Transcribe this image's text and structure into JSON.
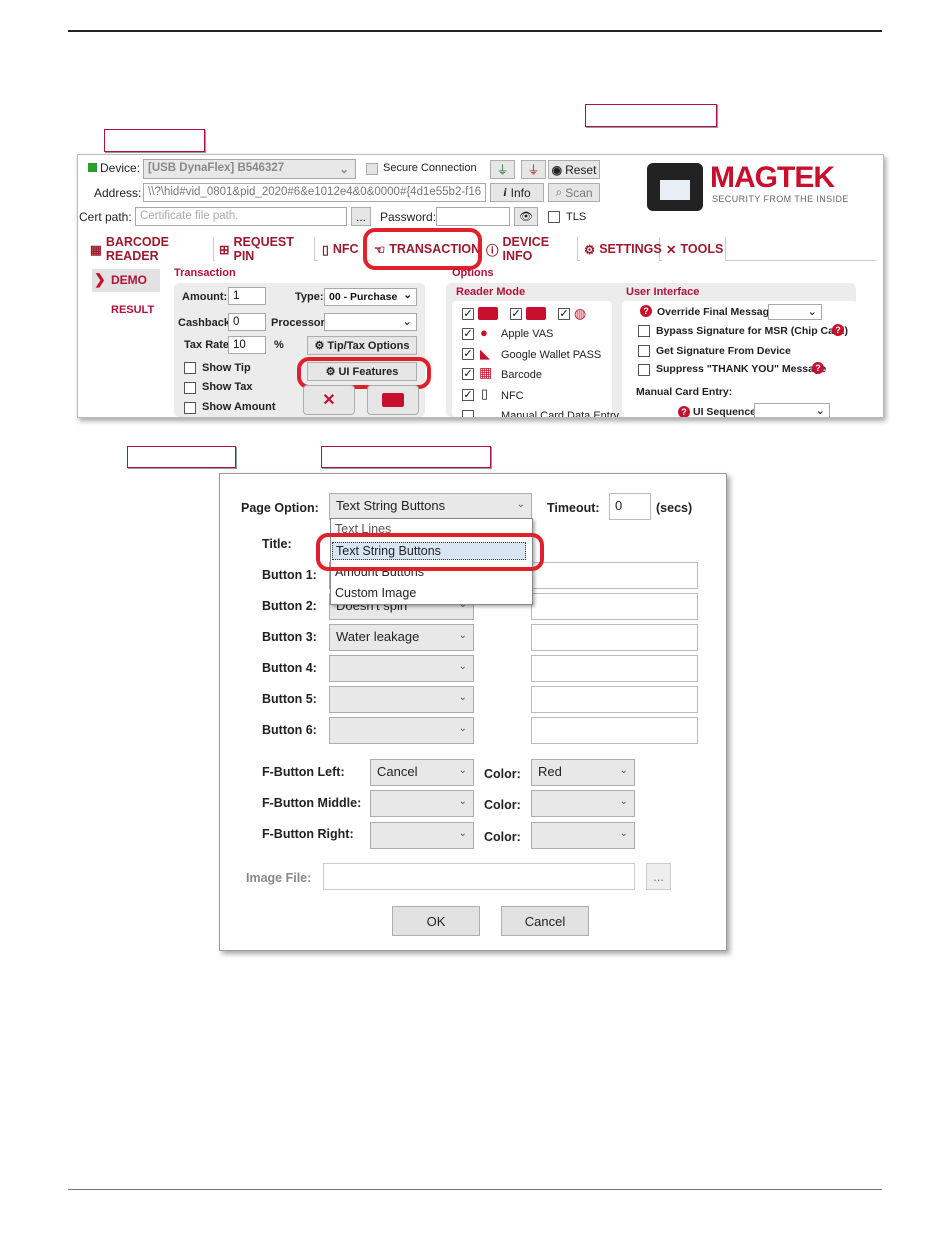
{
  "app": {
    "device_label": "Device:",
    "device_value": "[USB DynaFlex] B546327",
    "secure_connection": "Secure Connection",
    "reset": "Reset",
    "address_label": "Address:",
    "address_value": "\\\\?\\hid#vid_0801&pid_2020#6&e1012e4&0&0000#{4d1e55b2-f16",
    "info": "Info",
    "scan": "Scan",
    "cert_label": "Cert path:",
    "cert_placeholder": "Certificate file path.",
    "browse": "...",
    "password_label": "Password:",
    "tls": "TLS",
    "brand": "MAGTEK",
    "brand_tagline": "SECURITY FROM THE INSIDE",
    "tabs": [
      "BARCODE READER",
      "REQUEST PIN",
      "NFC",
      "TRANSACTION",
      "DEVICE INFO",
      "SETTINGS",
      "TOOLS"
    ],
    "side": [
      "DEMO",
      "RESULT"
    ],
    "transaction": {
      "title": "Transaction",
      "amount_label": "Amount:",
      "amount": "1",
      "type_label": "Type:",
      "type": "00 - Purchase",
      "cashback_label": "Cashback:",
      "cashback": "0",
      "processor_label": "Processor:",
      "tax_label": "Tax Rate:",
      "tax": "10",
      "pct": "%",
      "tip_tax": "Tip/Tax Options",
      "show_tip": "Show Tip",
      "show_tax": "Show Tax",
      "show_amount": "Show Amount",
      "ui_features": "UI Features"
    },
    "options": {
      "title": "Options",
      "reader_mode": "Reader Mode",
      "apple_vas": "Apple VAS",
      "google_wallet": "Google Wallet PASS",
      "barcode": "Barcode",
      "nfc": "NFC",
      "manual": "Manual Card Data Entry"
    },
    "ui": {
      "title": "User Interface",
      "override": "Override Final Message:",
      "bypass": "Bypass Signature for MSR (Chip Card)",
      "get_sig": "Get Signature From Device",
      "suppress": "Suppress \"THANK YOU\" Message",
      "manual_entry": "Manual Card Entry:",
      "ui_sequence": "UI Sequence:"
    }
  },
  "dialog": {
    "page_option_label": "Page Option:",
    "page_option": "Text String Buttons",
    "timeout_label": "Timeout:",
    "timeout": "0",
    "secs": "(secs)",
    "title_label": "Title:",
    "button1_label": "Button 1:",
    "button2_label": "Button 2:",
    "button2": "Doesn't spin",
    "button3_label": "Button 3:",
    "button3": "Water leakage",
    "button4_label": "Button 4:",
    "button5_label": "Button 5:",
    "button6_label": "Button 6:",
    "fleft_label": "F-Button Left:",
    "fleft": "Cancel",
    "fmiddle_label": "F-Button Middle:",
    "fright_label": "F-Button Right:",
    "color_label": "Color:",
    "color_left": "Red",
    "image_file_label": "Image File:",
    "browse": "...",
    "ok": "OK",
    "cancel": "Cancel",
    "dropdown": [
      "Text Lines",
      "Text String Buttons",
      "Amount Buttons",
      "Custom Image"
    ]
  },
  "colors": {
    "accent": "#b0123a",
    "highlight": "#e0202a",
    "device_status": "#2a9d2a"
  }
}
